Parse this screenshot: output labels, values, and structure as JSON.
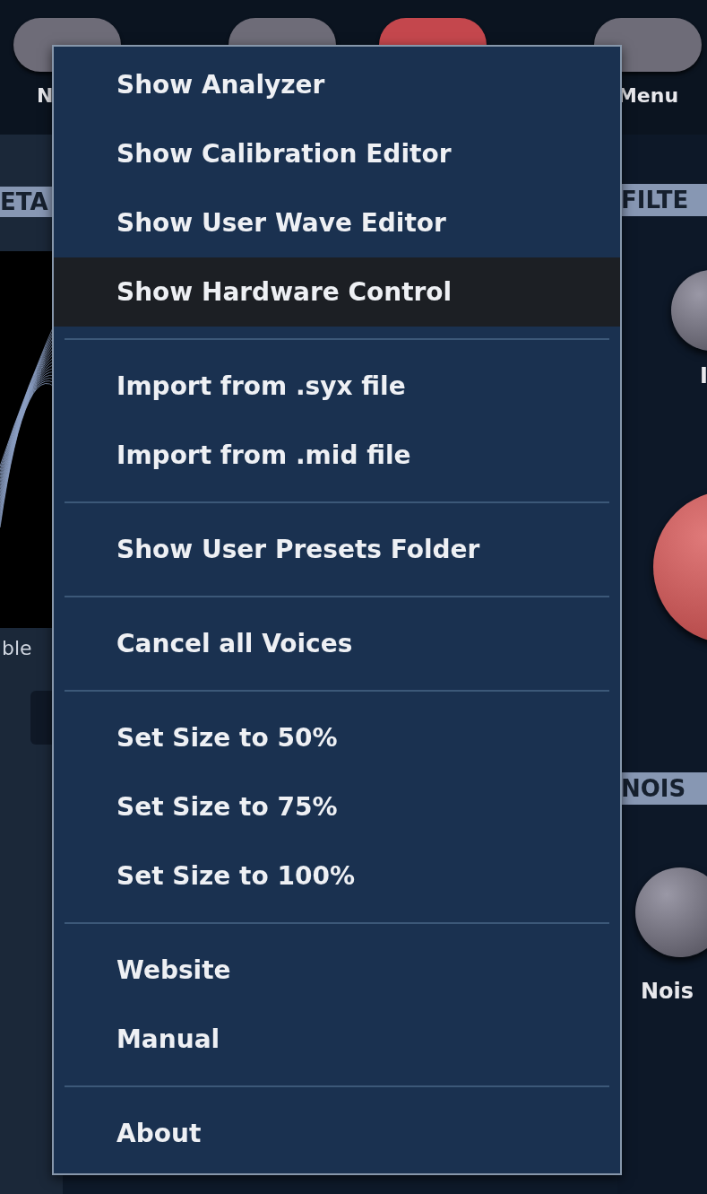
{
  "header": {
    "buttons": [
      {
        "label": "N",
        "selected": false
      },
      {
        "selected": false
      },
      {
        "selected": true
      },
      {
        "label": "Menu",
        "selected": false
      }
    ]
  },
  "left_panel": {
    "section_title": "ETA",
    "wavetable_label": "ble"
  },
  "right_panel": {
    "section_title": "FILTE",
    "knob_label": "I",
    "noise_section_title": "NOIS",
    "noise_knob_label": "Nois"
  },
  "menu": {
    "items": [
      {
        "kind": "item",
        "label": "Show Analyzer",
        "selected": false
      },
      {
        "kind": "item",
        "label": "Show Calibration Editor",
        "selected": false
      },
      {
        "kind": "item",
        "label": "Show User Wave Editor",
        "selected": false
      },
      {
        "kind": "item",
        "label": "Show Hardware Control",
        "selected": true
      },
      {
        "kind": "separator"
      },
      {
        "kind": "item",
        "label": "Import from .syx file",
        "selected": false
      },
      {
        "kind": "item",
        "label": "Import from .mid file",
        "selected": false
      },
      {
        "kind": "separator"
      },
      {
        "kind": "item",
        "label": "Show User Presets Folder",
        "selected": false
      },
      {
        "kind": "separator"
      },
      {
        "kind": "item",
        "label": "Cancel all Voices",
        "selected": false
      },
      {
        "kind": "separator"
      },
      {
        "kind": "item",
        "label": "Set Size to 50%",
        "selected": false
      },
      {
        "kind": "item",
        "label": "Set Size to 75%",
        "selected": false
      },
      {
        "kind": "item",
        "label": "Set Size to 100%",
        "selected": false
      },
      {
        "kind": "separator"
      },
      {
        "kind": "item",
        "label": "Website",
        "selected": false
      },
      {
        "kind": "item",
        "label": "Manual",
        "selected": false
      },
      {
        "kind": "separator"
      },
      {
        "kind": "item",
        "label": "About",
        "selected": false
      }
    ]
  }
}
